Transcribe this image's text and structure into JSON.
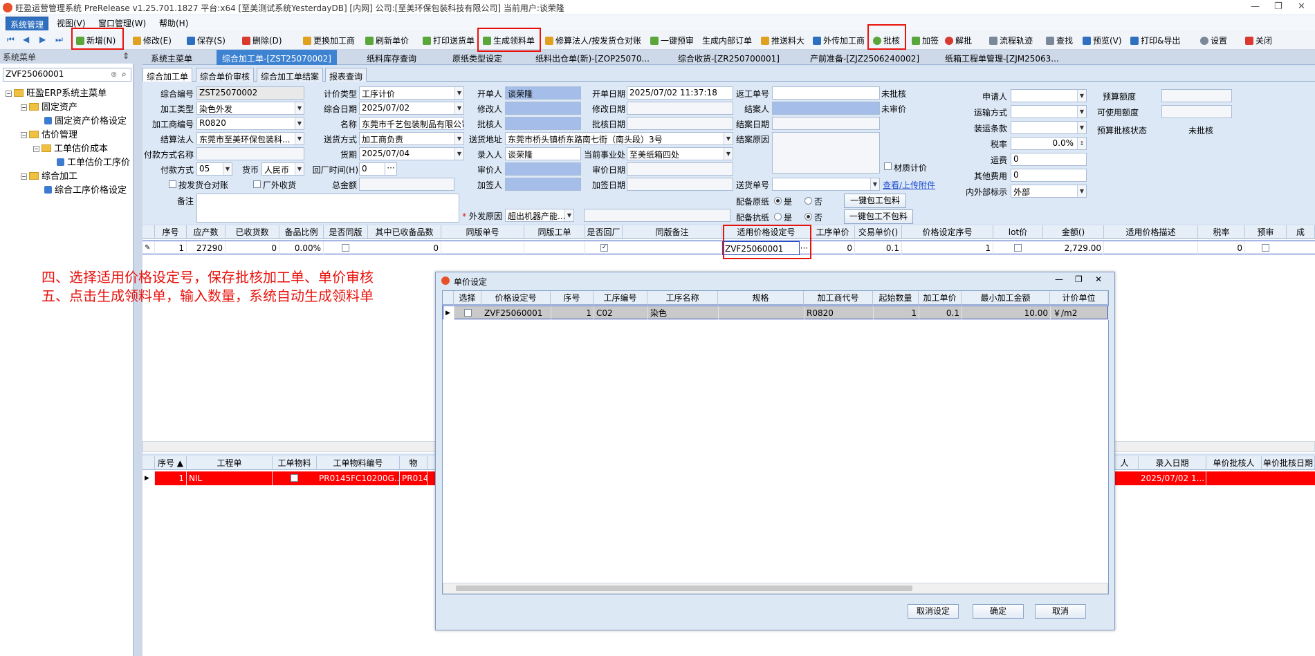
{
  "window": {
    "title": "旺盈运营管理系统 PreRelease v1.25.701.1827 平台:x64  [至美测试系统YesterdayDB] [内网] 公司:[至美环保包装科技有限公司] 当前用户:谈荣隆",
    "min": "—",
    "max": "❐",
    "close": "✕"
  },
  "menu": [
    "系统管理",
    "视图(V)",
    "窗口管理(W)",
    "帮助(H)"
  ],
  "toolbar": {
    "nav": [
      "⏮",
      "◀",
      "▶",
      "⏭"
    ],
    "items": [
      "新增(N)",
      "修改(E)",
      "保存(S)",
      "删除(D)",
      "更换加工商",
      "刷新单价",
      "打印送货单",
      "生成领料单",
      "修算法人/按发货仓对账",
      "一键预审",
      "生成内部订单",
      "推送料大",
      "外传加工商",
      "批核",
      "加签",
      "解批",
      "流程轨迹",
      "查找",
      "预览(V)",
      "打印&导出",
      "设置",
      "关闭"
    ]
  },
  "sidebar": {
    "header": "系统菜单",
    "pin": "⇕",
    "search_value": "ZVF25060001",
    "tree": [
      "旺盈ERP系统主菜单",
      "固定资产",
      "固定资产价格设定",
      "估价管理",
      "工单估价成本",
      "工单估价工序价",
      "综合加工",
      "综合工序价格设定"
    ]
  },
  "doc_tabs": [
    "系统主菜单",
    "综合加工单-[ZST25070002]",
    "纸料库存查询",
    "原纸类型设定",
    "纸料出仓单(新)-[ZOP25070...",
    "综合收货-[ZR250700001]",
    "产前准备-[ZJZ2506240002]",
    "纸箱工程单管理-[ZJM25063..."
  ],
  "sub_tabs": [
    "综合加工单",
    "综合单价审核",
    "综合加工单结案",
    "报表查询"
  ],
  "form": {
    "col1": {
      "综合编号": "ZST25070002",
      "加工类型": "染色外发",
      "加工商编号": "R0820",
      "结算法人": "东莞市至美环保包装科...",
      "付款方式名称": "",
      "付款方式": "05",
      "货币": "人民币",
      "回厂时间(H)": "0",
      "按发货仓对账": "按发货仓对账",
      "厂外收货": "厂外收货",
      "总金额": "",
      "备注": ""
    },
    "col2": {
      "计价类型": "工序计价",
      "综合日期": "2025/07/02",
      "名称": "东莞市千艺包装制品有限公司",
      "送货方式": "加工商负责",
      "货期": "2025/07/04"
    },
    "col3": {
      "开单人": "谈荣隆",
      "修改人": "",
      "批核人": "",
      "送货地址": "东莞市桥头镇桥东路南七街（南头段）3号",
      "录入人": "谈荣隆",
      "审价人": "",
      "加签人": "",
      "外发原因": "超出机器产能...",
      "外发原因_extra": ""
    },
    "col4": {
      "开单日期": "2025/07/02 11:37:18",
      "修改日期": "",
      "批核日期": "",
      "当前事业处": "至美纸箱四处",
      "审价日期": "",
      "加签日期": ""
    },
    "col5": {
      "返工单号": "",
      "结案人": "",
      "结案日期": "",
      "结案原因": "",
      "送货单号": "",
      "未批核": "未批核",
      "未审价": "未审价",
      "材质计价": "材质计价",
      "查看/上传附件": "查看/上传附件",
      "配备原纸": "配备原纸",
      "配备抗纸": "配备抗纸",
      "是": "是",
      "否": "否",
      "一键包工包料": "一键包工包料",
      "一键包工不包料": "一键包工不包料"
    },
    "col6": {
      "申请人": "",
      "运输方式": "",
      "装运条款": "",
      "税率": "0.0%",
      "运费": "0",
      "其他费用": "0",
      "内外部标示": "外部"
    },
    "col7": {
      "预算额度": "",
      "可使用额度": "",
      "预算批核状态": "预算批核状态",
      "预算批核状态值": "未批核"
    },
    "required_mark": "*"
  },
  "grid1": {
    "headers": [
      "序号",
      "应产数",
      "已收货数",
      "备品比例",
      "是否同版",
      "其中已收备品数",
      "同版单号",
      "同版工单",
      "是否回厂",
      "同版备注",
      "适用价格设定号",
      "工序单价",
      "交易单价()",
      "价格设定序号",
      "lot价",
      "金额()",
      "适用价格描述",
      "税率",
      "预审",
      "成"
    ],
    "row": [
      "1",
      "27290",
      "0",
      "0.00%",
      "",
      "0",
      "",
      "",
      "",
      "",
      "ZVF25060001",
      "0",
      "0.1",
      "1",
      "",
      "2,729.00",
      "",
      "0",
      "",
      ""
    ],
    "ellipsis": "···"
  },
  "grid2": {
    "headers": [
      "序号 ▲",
      "工程单",
      "工单物料",
      "工单物料编号",
      "物",
      "人",
      "录入日期",
      "单价批核人",
      "单价批核日期"
    ],
    "row": [
      "1",
      "NIL",
      "",
      "PR0145FC10200G...",
      "PR0145",
      "",
      "2025/07/02 1...",
      "",
      ""
    ]
  },
  "annotations": [
    "四、选择适用价格设定号，保存批核加工单、单价审核",
    "五、点击生成领料单，输入数量，系统自动生成领料单"
  ],
  "dialog": {
    "title": "单价设定",
    "headers": [
      "选择",
      "价格设定号",
      "序号",
      "工序编号",
      "工序名称",
      "规格",
      "加工商代号",
      "起始数量",
      "加工单价",
      "最小加工金额",
      "计价单位"
    ],
    "row": [
      "",
      "ZVF25060001",
      "1",
      "C02",
      "染色",
      "",
      "R0820",
      "1",
      "0.1",
      "10.00",
      "￥/m2"
    ],
    "buttons": [
      "取消设定",
      "确定",
      "取消"
    ]
  },
  "colors": {
    "accent": "#3e83d2",
    "highlight": "#e8120c",
    "selected_row": "#ff0000"
  }
}
